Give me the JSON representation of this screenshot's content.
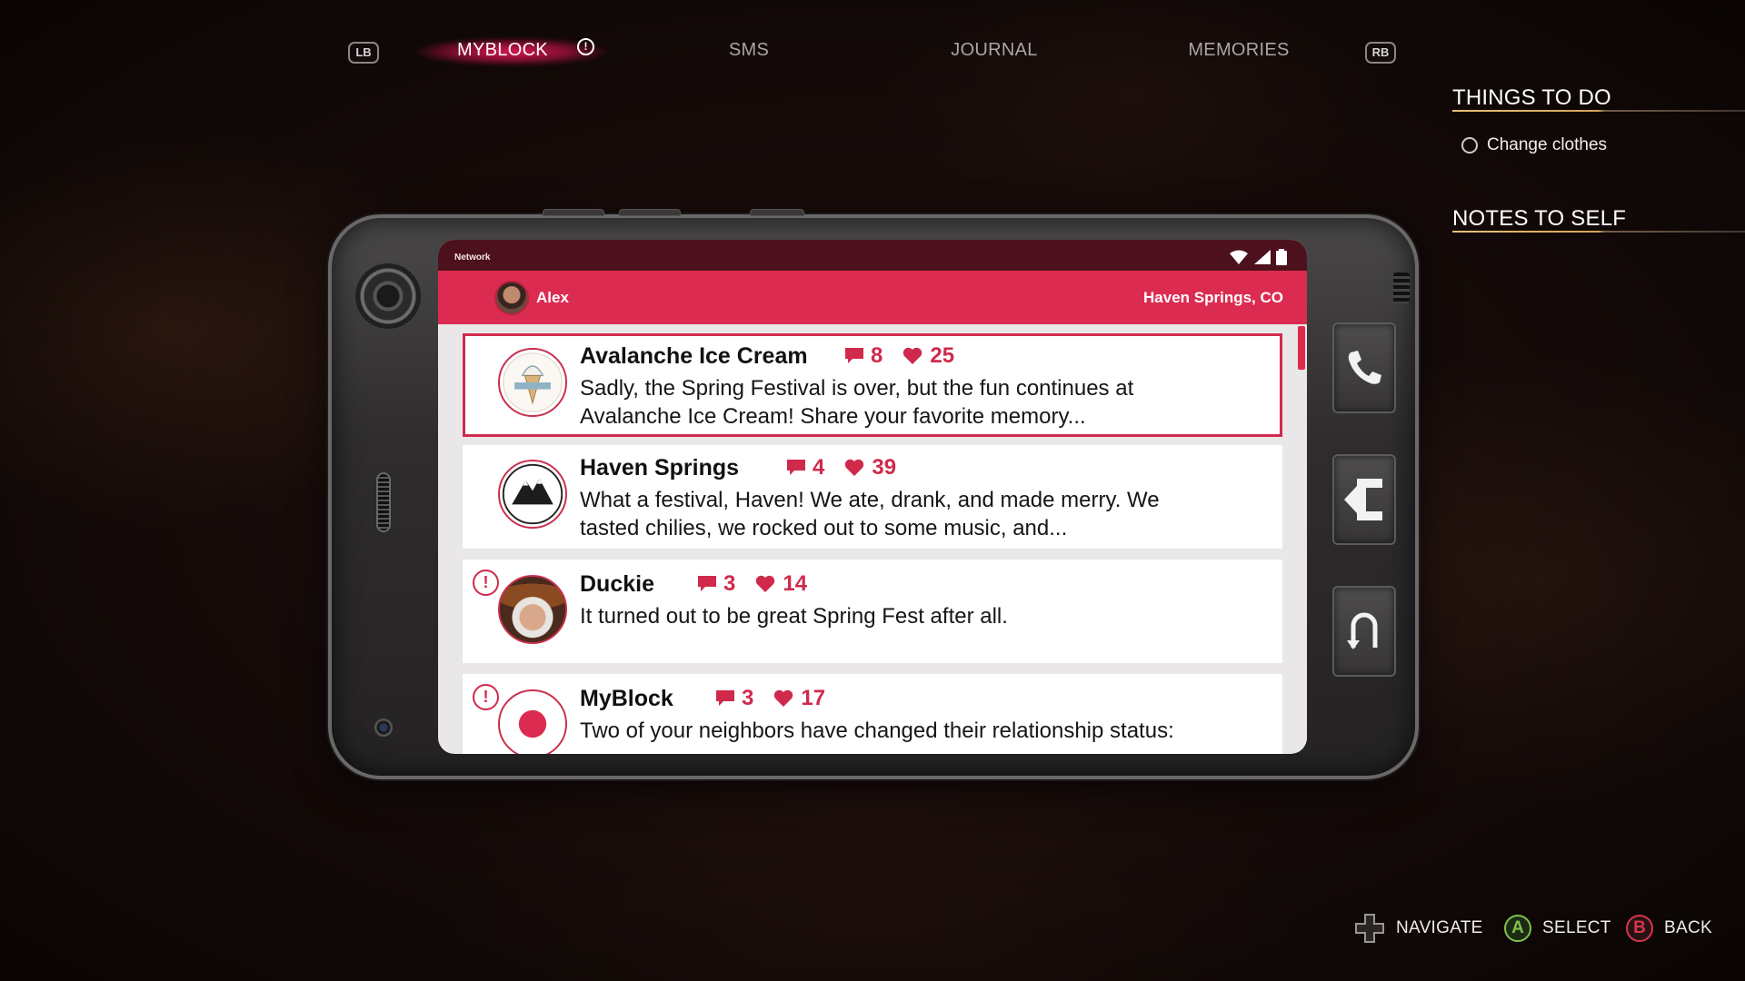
{
  "nav": {
    "lb": "LB",
    "rb": "RB",
    "tabs": [
      {
        "label": "MYBLOCK",
        "active": true,
        "alert": "!"
      },
      {
        "label": "SMS"
      },
      {
        "label": "JOURNAL"
      },
      {
        "label": "MEMORIES"
      }
    ]
  },
  "side": {
    "things_title": "THINGS TO DO",
    "todo": [
      {
        "label": "Change clothes",
        "done": false
      }
    ],
    "notes_title": "NOTES TO SELF"
  },
  "phone": {
    "status": {
      "network": "Network"
    },
    "appbar": {
      "user": "Alex",
      "location": "Haven Springs, CO"
    },
    "scroll_position": 0.0,
    "posts": [
      {
        "title": "Avalanche Ice Cream",
        "comments": "8",
        "likes": "25",
        "body": "Sadly, the Spring Festival is over, but the fun continues at Avalanche Ice Cream! Share your favorite memory...",
        "avatar_icon": "ice-cream-logo",
        "avatar_text": "Avalanche Ice Cream",
        "selected": true,
        "alert": false
      },
      {
        "title": "Haven Springs",
        "comments": "4",
        "likes": "39",
        "body": "What a festival, Haven! We ate, drank, and made merry. We tasted chilies, we rocked out to some music, and...",
        "avatar_icon": "mountain-town-logo",
        "avatar_text": "HAVEN SPRINGS, CO",
        "selected": false,
        "alert": false
      },
      {
        "title": "Duckie",
        "comments": "3",
        "likes": "14",
        "body": "It turned out to be great Spring Fest after all.",
        "avatar_icon": "person-photo",
        "selected": false,
        "alert": true,
        "alert_symbol": "!"
      },
      {
        "title": "MyBlock",
        "comments": "3",
        "likes": "17",
        "body": "Two of your neighbors have changed their relationship status:",
        "avatar_icon": "myblock-logo",
        "selected": false,
        "alert": true,
        "alert_symbol": "!"
      }
    ]
  },
  "shortcuts": [
    {
      "icon": "phone-icon"
    },
    {
      "icon": "exit-app-icon"
    },
    {
      "icon": "back-arrow-icon"
    }
  ],
  "hints": {
    "navigate": "NAVIGATE",
    "a": "A",
    "select": "SELECT",
    "b": "B",
    "back": "BACK"
  },
  "colors": {
    "accent": "#dc2b50",
    "status_bar": "#4c111c",
    "gold_rule": "#d4a655",
    "a_button": "#7fc24c",
    "b_button": "#d5364b"
  }
}
